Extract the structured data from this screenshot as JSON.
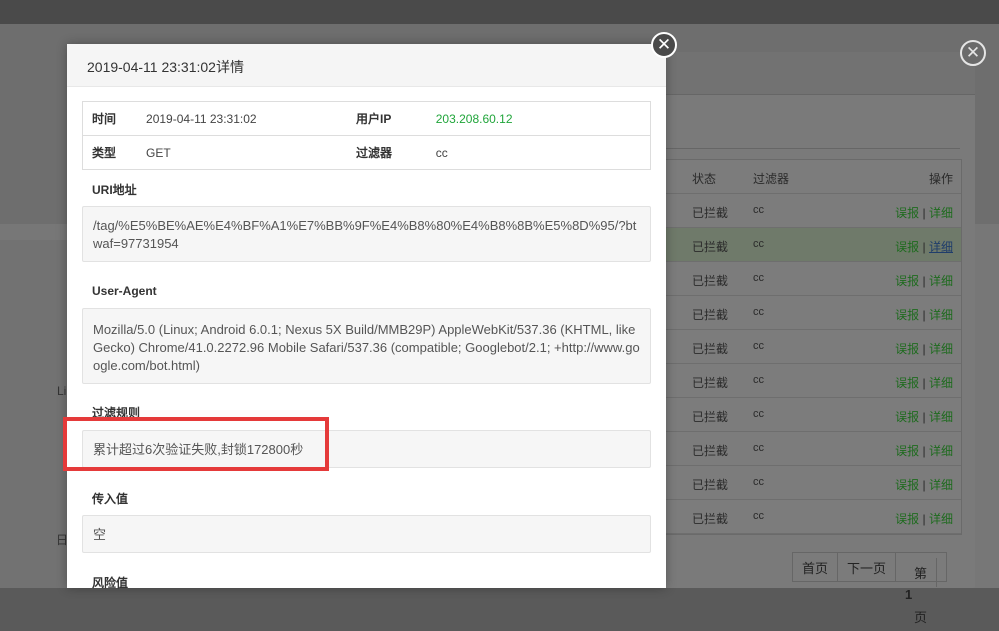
{
  "dialog": {
    "title": "2019-04-11 23:31:02详情",
    "close_icon": "close-icon",
    "info": {
      "time_label": "时间",
      "time_value": "2019-04-11 23:31:02",
      "ip_label": "用户IP",
      "ip_value": "203.208.60.12",
      "type_label": "类型",
      "type_value": "GET",
      "filter_label": "过滤器",
      "filter_value": "cc"
    },
    "uri_label": "URI地址",
    "uri_value": "/tag/%E5%BE%AE%E4%BF%A1%E7%BB%9F%E4%B8%80%E4%B8%8B%E5%8D%95/?btwaf=97731954",
    "ua_label": "User-Agent",
    "ua_value": "Mozilla/5.0 (Linux; Android 6.0.1; Nexus 5X Build/MMB29P) AppleWebKit/537.36 (KHTML, like Gecko) Chrome/41.0.2272.96 Mobile Safari/537.36 (compatible; Googlebot/2.1; +http://www.google.com/bot.html)",
    "rule_label": "过滤规则",
    "rule_value": "累计超过6次验证失败,封锁172800秒",
    "input_label": "传入值",
    "input_value": "空",
    "risk_label": "风险值"
  },
  "back_table": {
    "headers": {
      "status": "状态",
      "filter": "过滤器",
      "action": "操作"
    },
    "rows": [
      {
        "status": "已拦截",
        "filter": "cc",
        "report": "误报",
        "sep": "|",
        "detail": "详细"
      },
      {
        "status": "已拦截",
        "filter": "cc",
        "report": "误报",
        "sep": "|",
        "detail": "详细"
      },
      {
        "status": "已拦截",
        "filter": "cc",
        "report": "误报",
        "sep": "|",
        "detail": "详细"
      },
      {
        "status": "已拦截",
        "filter": "cc",
        "report": "误报",
        "sep": "|",
        "detail": "详细"
      },
      {
        "status": "已拦截",
        "filter": "cc",
        "report": "误报",
        "sep": "|",
        "detail": "详细"
      },
      {
        "status": "已拦截",
        "filter": "cc",
        "report": "误报",
        "sep": "|",
        "detail": "详细"
      },
      {
        "status": "已拦截",
        "filter": "cc",
        "report": "误报",
        "sep": "|",
        "detail": "详细"
      },
      {
        "status": "已拦截",
        "filter": "cc",
        "report": "误报",
        "sep": "|",
        "detail": "详细"
      },
      {
        "status": "已拦截",
        "filter": "cc",
        "report": "误报",
        "sep": "|",
        "detail": "详细"
      },
      {
        "status": "已拦截",
        "filter": "cc",
        "report": "误报",
        "sep": "|",
        "detail": "详细"
      }
    ],
    "pager": {
      "first": "首页",
      "next": "下一页",
      "current_prefix": "第",
      "current_num": "1",
      "current_suffix": "页"
    }
  },
  "background": {
    "side_text_1": "Li",
    "side_text_2": "日"
  },
  "colors": {
    "ip_green": "#20a53a",
    "highlight_red": "#e53a3a"
  }
}
